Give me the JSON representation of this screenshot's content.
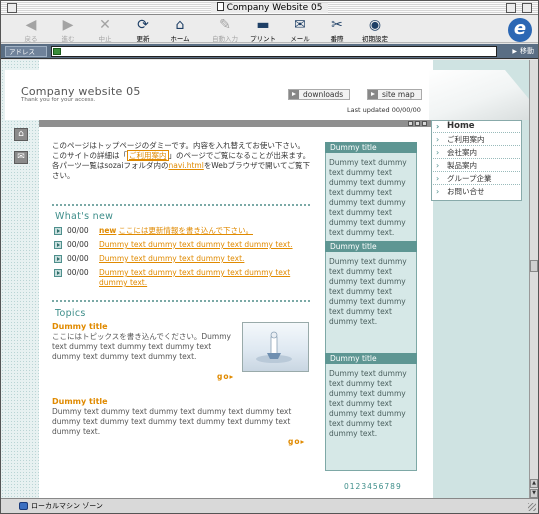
{
  "window": {
    "title": "Company Website 05"
  },
  "toolbar": {
    "back": "戻る",
    "forward": "進む",
    "stop": "中止",
    "refresh": "更新",
    "home": "ホーム",
    "autofill": "自動入力",
    "print": "プリント",
    "mail": "メール",
    "preferences": "番際",
    "initial_settings": "初期設定"
  },
  "address_bar": {
    "label": "アドレス",
    "value": "",
    "go_label": "移動"
  },
  "page": {
    "site_title": "Company website 05",
    "site_subtitle": "Thank you for your access.",
    "downloads": "downloads",
    "site_map": "site map",
    "last_updated": "Last updated 00/00/00",
    "intro": {
      "line1": "このページはトップページのダミーです。内容を入れ替えてお使い下さい。このサイトの詳細は「",
      "link1": "ご利用案内",
      "line2": "」のページでご覧になることが出来ます。",
      "line3": "各パーツ一覧はsozaiフォルダ内の",
      "link2": "navi.html",
      "line4": "をWebブラウザで開いてご覧下さい。"
    },
    "whats_new": {
      "title": "What's new",
      "items": [
        {
          "date": "00/00",
          "badge": "new",
          "text": "ここには更新情報を書き込んで下さい。"
        },
        {
          "date": "00/00",
          "text": "Dummy text dummy text dummy text dummy text."
        },
        {
          "date": "00/00",
          "text": "Dummy text dummy text dummy text."
        },
        {
          "date": "00/00",
          "text": "Dummy text dummy text dummy text dummy text dummy text."
        }
      ]
    },
    "topics": {
      "title": "Topics",
      "items": [
        {
          "heading": "Dummy title",
          "body": "ここにはトピックスを書き込んでください。Dummy text dummy text dummy text dummy text dummy text dummy text dummy text.",
          "go": "go"
        },
        {
          "heading": "Dummy title",
          "body": "Dummy text dummy text dummy text dummy text dummy text dummy text dummy text dummy text dummy text dummy text dummy text.",
          "go": "go"
        }
      ]
    },
    "middle_boxes": [
      {
        "title": "Dummy title",
        "body": "Dummy text dummy text dummy text dummy text dummy text dummy text dummy text dummy text dummy text dummy text dummy text dummy text."
      },
      {
        "title": "Dummy title",
        "body": "Dummy text dummy text dummy text dummy text dummy text dummy text dummy text dummy text dummy text dummy text."
      },
      {
        "title": "Dummy title",
        "body": "Dummy text dummy text dummy text dummy text dummy text dummy text dummy text dummy text dummy text dummy text."
      }
    ],
    "nav": {
      "items": [
        "Home",
        "ご利用案内",
        "会社案内",
        "製品案内",
        "グループ企業",
        "お問い合せ"
      ]
    },
    "footer": "0123456789"
  },
  "status_bar": {
    "zone": "ローカルマシン ゾーン"
  }
}
